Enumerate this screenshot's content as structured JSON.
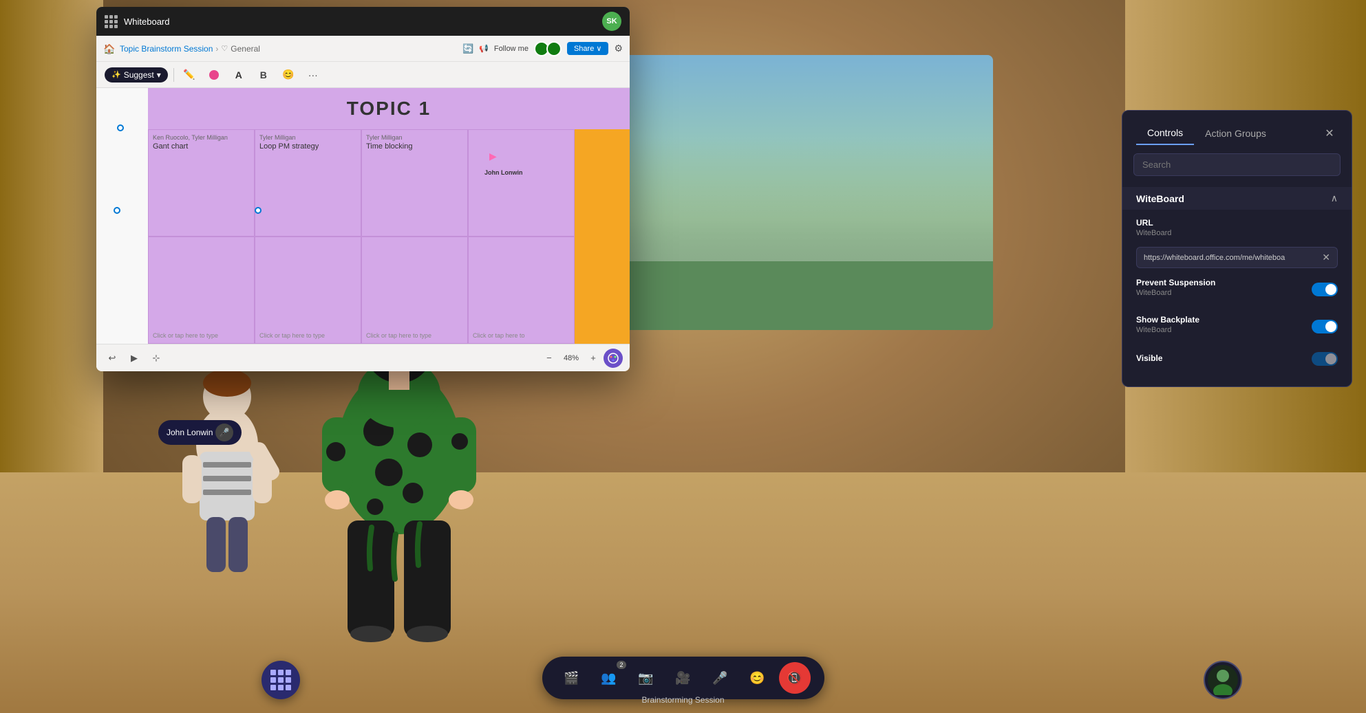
{
  "app": {
    "title": "Whiteboard"
  },
  "whiteboard": {
    "title_bar_label": "Whiteboard",
    "session_name": "Topic Brainstorm Session",
    "breadcrumb_separator": ">",
    "breadcrumb_sub": "General",
    "follow_me_label": "Follow me",
    "share_label": "Share ∨",
    "settings_icon": "⚙",
    "toolbar": {
      "suggest_label": "Suggest",
      "suggest_dropdown": "▾",
      "pen_icon": "✏",
      "circle_icon": "⬤",
      "text_icon": "A",
      "bold_icon": "B",
      "emoji_icon": "😊",
      "more_icon": "···"
    },
    "canvas": {
      "topic_title": "TOPIC 1",
      "sticky_notes": [
        {
          "author": "Ken Ruocolo, Tyler Milligan",
          "title": "Gant chart",
          "placeholder": "",
          "col": 0,
          "row": 0
        },
        {
          "author": "Tyler Milligan",
          "title": "Loop PM strategy",
          "placeholder": "",
          "col": 1,
          "row": 0
        },
        {
          "author": "Tyler Milligan",
          "title": "Time blocking",
          "placeholder": "",
          "col": 2,
          "row": 0
        },
        {
          "author": "",
          "title": "",
          "placeholder": "",
          "col": 3,
          "row": 0
        },
        {
          "author": "",
          "title": "",
          "placeholder": "Click or tap here to type",
          "col": 0,
          "row": 1
        },
        {
          "author": "",
          "title": "",
          "placeholder": "Click or tap here to type",
          "col": 1,
          "row": 1
        },
        {
          "author": "",
          "title": "",
          "placeholder": "Click or tap here to type",
          "col": 2,
          "row": 1
        },
        {
          "author": "",
          "title": "",
          "placeholder": "Click or tap here to type",
          "col": 3,
          "row": 1
        }
      ],
      "zoom_level": "48%",
      "user_cursor_label": "John Lonwin"
    },
    "bottom_bar": {
      "undo_icon": "↩",
      "cursor_icon": "▶",
      "fit_icon": "⧉"
    }
  },
  "controls_panel": {
    "tab_controls": "Controls",
    "tab_action_groups": "Action Groups",
    "close_icon": "✕",
    "search_placeholder": "Search",
    "section_title": "WiteBoard",
    "chevron_up": "∧",
    "items": [
      {
        "label": "URL",
        "sublabel": "WiteBoard",
        "type": "url",
        "value": "https://whiteboard.office.com/me/whiteboa"
      },
      {
        "label": "Prevent Suspension",
        "sublabel": "WiteBoard",
        "type": "toggle",
        "enabled": true
      },
      {
        "label": "Show Backplate",
        "sublabel": "WiteBoard",
        "type": "toggle",
        "enabled": true
      },
      {
        "label": "Visible",
        "sublabel": "",
        "type": "toggle",
        "enabled": true
      }
    ]
  },
  "taskbar": {
    "session_label": "Brainstorming Session",
    "buttons": [
      {
        "id": "screen",
        "icon": "🎬",
        "label": ""
      },
      {
        "id": "people",
        "icon": "👥",
        "label": "2"
      },
      {
        "id": "camera",
        "icon": "📷",
        "label": ""
      },
      {
        "id": "video",
        "icon": "🎥",
        "label": ""
      },
      {
        "id": "mute",
        "icon": "🎤",
        "label": ""
      },
      {
        "id": "emoji",
        "icon": "😊",
        "label": ""
      },
      {
        "id": "leave",
        "icon": "📵",
        "label": "",
        "active": true
      }
    ],
    "apps_icon": "⋯",
    "user_initials": "SK"
  },
  "user_label": {
    "name": "John Lonwin",
    "mic_icon": "🎤"
  }
}
